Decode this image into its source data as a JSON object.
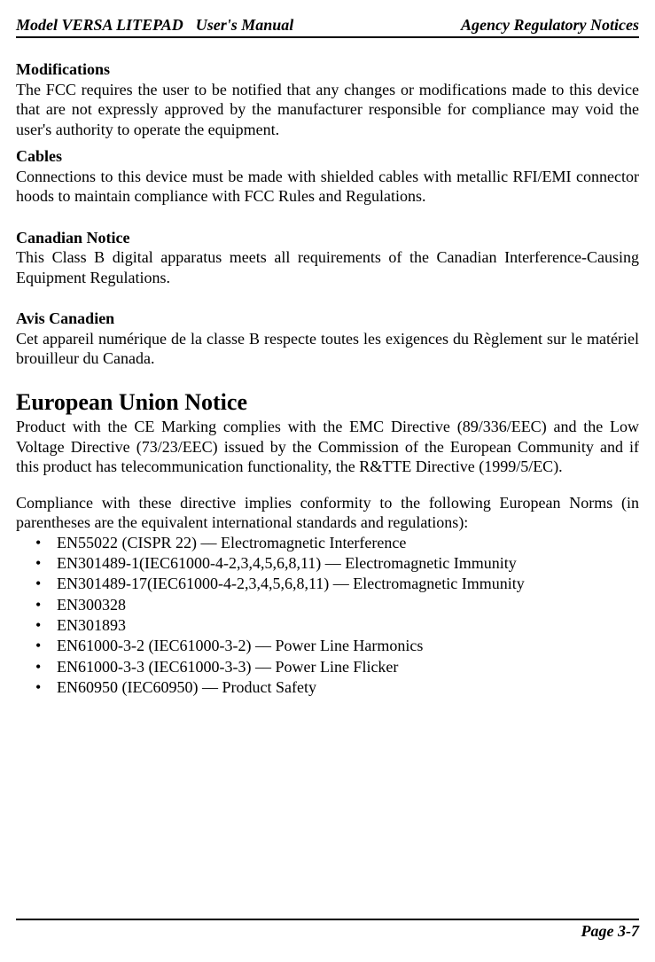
{
  "header": {
    "model": "Model VERSA LITEPAD",
    "manual": "User's Manual",
    "section": "Agency Regulatory Notices"
  },
  "sections": {
    "modifications": {
      "heading": "Modifications",
      "body": "The FCC requires the user to be notified that any changes or modifications made to this device that are not expressly approved by the manufacturer responsible for compliance may void the user's authority to operate the equipment."
    },
    "cables": {
      "heading": "Cables",
      "body": "Connections to this device must be made with shielded cables with metallic RFI/EMI connector hoods to maintain compliance with FCC Rules and Regulations."
    },
    "canadian": {
      "heading": "Canadian Notice",
      "body": "This Class B digital apparatus meets all requirements of the Canadian Interference-Causing Equipment Regulations."
    },
    "avis": {
      "heading": "Avis Canadien",
      "body": "Cet appareil numérique de la classe B respecte toutes les exigences du Règlement sur le matériel brouilleur du Canada."
    },
    "eu": {
      "heading": "European Union Notice",
      "body1": "Product with the CE Marking complies with the EMC Directive (89/336/EEC) and the Low Voltage Directive (73/23/EEC) issued by the Commission of the European Community and if this product has telecommunication functionality, the R&TTE Directive (1999/5/EC).",
      "body2": "Compliance with these directive implies conformity to the following European Norms (in parentheses are the equivalent international standards and regulations):",
      "items": [
        "EN55022 (CISPR 22) –– Electromagnetic Interference",
        "EN301489-1(IEC61000-4-2,3,4,5,6,8,11) –– Electromagnetic Immunity",
        "EN301489-17(IEC61000-4-2,3,4,5,6,8,11) –– Electromagnetic Immunity",
        "EN300328",
        "EN301893",
        "EN61000-3-2 (IEC61000-3-2) –– Power Line Harmonics",
        "EN61000-3-3 (IEC61000-3-3) –– Power Line Flicker",
        "EN60950 (IEC60950) –– Product Safety"
      ]
    }
  },
  "footer": {
    "page": "Page 3-7"
  }
}
